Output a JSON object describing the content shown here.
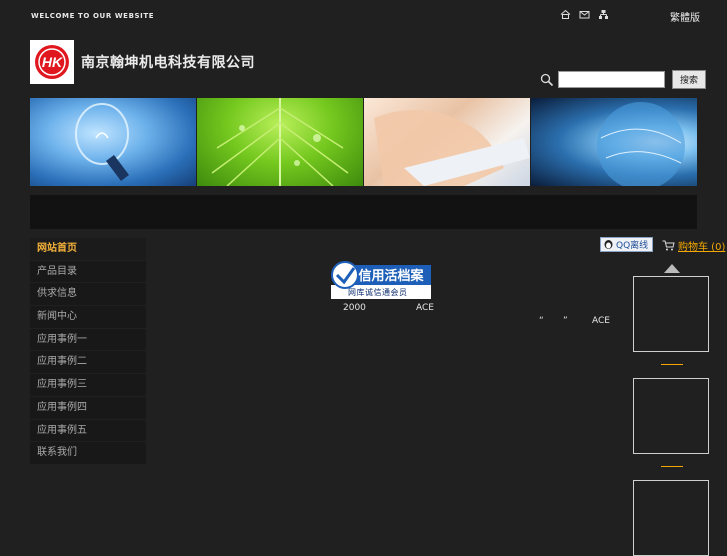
{
  "header": {
    "welcome": "WELCOME TO OUR WEBSITE",
    "icons": [
      "home-icon",
      "mail-icon",
      "sitemap-icon"
    ],
    "lang_link": "繁體版"
  },
  "brand": {
    "logo_text": "HK",
    "company_name": "南京翰坤机电科技有限公司",
    "logo_colors": {
      "ring": "#e0171f",
      "inner": "#ffffff"
    }
  },
  "search": {
    "placeholder": "",
    "button_label": "搜索"
  },
  "sidebar": {
    "items": [
      {
        "label": "网站首页"
      },
      {
        "label": "产品目录"
      },
      {
        "label": "供求信息"
      },
      {
        "label": "新闻中心"
      },
      {
        "label": "应用事例一"
      },
      {
        "label": "应用事例二"
      },
      {
        "label": "应用事例三"
      },
      {
        "label": "应用事例四"
      },
      {
        "label": "应用事例五"
      },
      {
        "label": "联系我们"
      }
    ],
    "active_index": 0,
    "accent": "#f4b23a"
  },
  "main": {
    "badge_title": "信用活档案",
    "badge_sub": "网库诚信通会员",
    "text_year": "2000",
    "text_brand1": "ACE",
    "text_quote_open": "“",
    "text_quote_close": "”",
    "text_brand2": "ACE"
  },
  "right": {
    "qq_label": "QQ离线",
    "cart_label": "购物车 (0)"
  },
  "colors": {
    "background": "#202020",
    "accent_orange": "#f4a700"
  }
}
